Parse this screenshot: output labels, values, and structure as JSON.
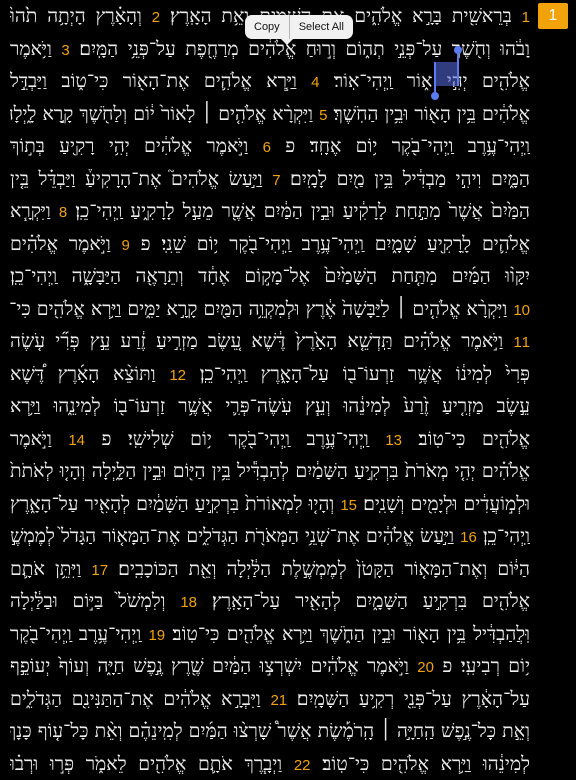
{
  "chapter_badge": "1",
  "context_menu": {
    "copy": "Copy",
    "select_all": "Select All"
  },
  "lines": [
    [
      [
        "v",
        "1"
      ],
      [
        "t",
        " בְּרֵאשִׁ֖ית בָּרָ֣א אֱלֹהִ֑ים אֵ֥ת הַשָּׁמַ֖יִם וְאֵ֥ת הָאָֽרֶץ׃ "
      ],
      [
        "v",
        "2"
      ],
      [
        "t",
        " וְהָאָ֗רֶץ הָיְתָ֥ה תֹ֙הוּ֙"
      ]
    ],
    [
      [
        "t",
        "וָבֹ֔הוּ וְחֹ֖שֶׁךְ עַל־פְּנֵ֣י תְה֑וֹם וְר֣וּחַ אֱלֹהִ֔ים מְרַחֶ֖פֶת עַל־פְּנֵ֥י הַמָּֽיִם׃ "
      ],
      [
        "v",
        "3"
      ],
      [
        "t",
        " וַיֹּ֥אמֶר"
      ]
    ],
    [
      [
        "t",
        "אֱלֹהִ֖ים יְהִ֣י א֑וֹר וַֽיְהִי־אֽוֹר׃ "
      ],
      [
        "v",
        "4"
      ],
      [
        "t",
        " וַיַּ֧רְא אֱלֹהִ֛ים אֶת־הָא֖וֹר כִּי־ט֑וֹב וַיַּבְדֵּ֣ל"
      ]
    ],
    [
      [
        "t",
        "אֱלֹהִ֔ים בֵּ֥ין הָא֖וֹר וּבֵ֥ין הַחֹֽשֶׁךְ׃ "
      ],
      [
        "v",
        "5"
      ],
      [
        "t",
        " וַיִּקְרָ֨א אֱלֹהִ֤ים ׀ לָאוֹר֙ י֔וֹם וְלַחֹ֖שֶׁךְ קָ֣רָא לָ֑יְלָה"
      ]
    ],
    [
      [
        "t",
        "וַֽיְהִי־עֶ֥רֶב וַֽיְהִי־בֹ֖קֶר י֥וֹם אֶחָֽד׃ פ "
      ],
      [
        "v",
        "6"
      ],
      [
        "t",
        " וַיֹּ֣אמֶר אֱלֹהִ֔ים יְהִ֥י רָקִ֖יעַ בְּת֣וֹךְ"
      ]
    ],
    [
      [
        "t",
        "הַמָּ֑יִם וִיהִ֣י מַבְדִּ֔יל בֵּ֥ין מַ֖יִם לָמָֽיִם׃ "
      ],
      [
        "v",
        "7"
      ],
      [
        "t",
        " וַיַּ֣עַשׂ אֱלֹהִים֮ אֶת־הָרָקִיעַ֒ וַיַּבְדֵּ֗ל בֵּ֤ין"
      ]
    ],
    [
      [
        "t",
        "הַמַּ֙יִם֙ אֲשֶׁר֙ מִתַּ֣חַת לָרָקִ֔יעַ וּבֵ֣ין הַמַּ֔יִם אֲשֶׁ֖ר מֵעַ֣ל לָרָקִ֑יעַ וַֽיְהִי־כֵֽן׃ "
      ],
      [
        "v",
        "8"
      ],
      [
        "t",
        " וַיִּקְרָ֧א"
      ]
    ],
    [
      [
        "t",
        "אֱלֹהִ֛ים לָֽרָקִ֖יעַ שָׁמָ֑יִם וַֽיְהִי־עֶ֥רֶב וַֽיְהִי־בֹ֖קֶר י֥וֹם שֵׁנִֽי׃ פ "
      ],
      [
        "v",
        "9"
      ],
      [
        "t",
        " וַיֹּ֣אמֶר אֱלֹהִ֗ים"
      ]
    ],
    [
      [
        "t",
        "יִקָּו֨וּ הַמַּ֜יִם מִתַּ֤חַת הַשָּׁמַ֙יִם֙ אֶל־מָק֣וֹם אֶחָ֔ד וְתֵרָאֶ֖ה הַיַּבָּשָׁ֑ה וַֽיְהִי־כֵֽן׃"
      ]
    ],
    [
      [
        "v",
        "10"
      ],
      [
        "t",
        " וַיִּקְרָ֨א אֱלֹהִ֤ים ׀ לַיַּבָּשָׁה֙ אֶ֔רֶץ וּלְמִקְוֵ֥ה הַמַּ֖יִם קָרָ֣א יַמִּ֑ים וַיַּ֥רְא אֱלֹהִ֖ים כִּי־טֽוֹב׃"
      ]
    ],
    [
      [
        "v",
        "11"
      ],
      [
        "t",
        " וַיֹּ֣אמֶר אֱלֹהִ֗ים תַּֽדְשֵׁ֤א הָאָ֙רֶץ֙ דֶּ֔שֶׁא עֵ֚שֶׂב מַזְרִ֣יעַ זֶ֔רַע עֵ֣ץ פְּרִ֞י עֹ֤שֶׂה"
      ]
    ],
    [
      [
        "t",
        "פְּרִי֙ לְמִינ֔וֹ אֲשֶׁ֥ר זַרְעוֹ־ב֖וֹ עַל־הָאָ֑רֶץ וַֽיְהִי־כֵֽן׃ "
      ],
      [
        "v",
        "12"
      ],
      [
        "t",
        " וַתּוֹצֵ֨א הָאָ֜רֶץ דֶּ֠שֶׁא"
      ]
    ],
    [
      [
        "t",
        "עֵ֣שֶׂב מַזְרִ֤יעַ זֶ֙רַע֙ לְמִינֵ֔הוּ וְעֵ֧ץ עֹֽשֶׂה־פְּרִ֛י אֲשֶׁ֥ר זַרְעוֹ־ב֖וֹ לְמִינֵ֑הוּ וַיַּ֥רְא"
      ]
    ],
    [
      [
        "t",
        "אֱלֹהִ֖ים כִּי־טֽוֹב׃ "
      ],
      [
        "v",
        "13"
      ],
      [
        "t",
        " וַֽיְהִי־עֶ֥רֶב וַֽיְהִי־בֹ֖קֶר י֥וֹם שְׁלִישִֽׁי׃ פ "
      ],
      [
        "v",
        "14"
      ],
      [
        "t",
        " וַיֹּ֣אמֶר"
      ]
    ],
    [
      [
        "t",
        "אֱלֹהִ֗ים יְהִ֤י מְאֹרֹת֙ בִּרְקִ֣יעַ הַשָּׁמַ֔יִם לְהַבְדִּ֕יל בֵּ֥ין הַיּ֖וֹם וּבֵ֣ין הַלָּ֑יְלָה וְהָי֤וּ לְאֹתֹת֙"
      ]
    ],
    [
      [
        "t",
        "וּלְמ֣וֹעֲדִ֔ים וּלְיָמִ֖ים וְשָׁנִֽים׃ "
      ],
      [
        "v",
        "15"
      ],
      [
        "t",
        " וְהָי֤וּ לִמְאוֹרֹת֙ בִּרְקִ֣יעַ הַשָּׁמַ֔יִם לְהָאִ֖יר עַל־הָאָ֑רֶץ"
      ]
    ],
    [
      [
        "t",
        "וַֽיְהִי־כֵֽן׃ "
      ],
      [
        "v",
        "16"
      ],
      [
        "t",
        " וַיַּ֣עַשׂ אֱלֹהִ֔ים אֶת־שְׁנֵ֥י הַמְּאֹרֹ֖ת הַגְּדֹלִ֑ים אֶת־הַמָּא֤וֹר הַגָּדֹל֙ לְמֶמְשֶׁ֣לֶת"
      ]
    ],
    [
      [
        "t",
        "הַיּ֔וֹם וְאֶת־הַמָּא֤וֹר הַקָּטֹן֙ לְמֶמְשֶׁ֣לֶת הַלַּ֔יְלָה וְאֵ֖ת הַכּוֹכָבִֽים׃ "
      ],
      [
        "v",
        "17"
      ],
      [
        "t",
        " וַיִּתֵּ֥ן אֹתָ֛ם"
      ]
    ],
    [
      [
        "t",
        "אֱלֹהִ֖ים בִּרְקִ֣יעַ הַשָּׁמָ֑יִם לְהָאִ֖יר עַל־הָאָֽרֶץ׃ "
      ],
      [
        "v",
        "18"
      ],
      [
        "t",
        " וְלִמְשֹׁל֙ בַּיּ֣וֹם וּבַלַּ֔יְלָה"
      ]
    ],
    [
      [
        "t",
        "וּֽלֲהַבְדִּ֔יל בֵּ֥ין הָא֖וֹר וּבֵ֣ין הַחֹ֑שֶׁךְ וַיַּ֥רְא אֱלֹהִ֖ים כִּי־טֽוֹב׃ "
      ],
      [
        "v",
        "19"
      ],
      [
        "t",
        " וַֽיְהִי־עֶ֥רֶב וַֽיְהִי־בֹ֖קֶר"
      ]
    ],
    [
      [
        "t",
        "י֥וֹם רְבִיעִֽי׃ פ "
      ],
      [
        "v",
        "20"
      ],
      [
        "t",
        " וַיֹּ֣אמֶר אֱלֹהִ֔ים יִשְׁרְצ֣וּ הַמַּ֔יִם שֶׁ֖רֶץ נֶ֣פֶשׁ חַיָּ֑ה וְעוֹף֙ יְעוֹפֵ֣ף"
      ]
    ],
    [
      [
        "t",
        "עַל־הָאָ֔רֶץ עַל־פְּנֵ֖י רְקִ֥יעַ הַשָּׁמָֽיִם׃ "
      ],
      [
        "v",
        "21"
      ],
      [
        "t",
        " וַיִּבְרָ֣א אֱלֹהִ֔ים אֶת־הַתַּנִּינִ֖ם הַגְּדֹלִ֑ים"
      ]
    ],
    [
      [
        "t",
        "וְאֵ֣ת כָּל־נֶ֣פֶשׁ הַֽחַיָּ֣ה ׀ הָֽרֹמֶ֡שֶׂת אֲשֶׁר֩ שָׁרְצ֨וּ הַמַּ֜יִם לְמִֽינֵהֶ֗ם וְאֵ֨ת כָּל־ע֤וֹף כָּנָף֙"
      ]
    ],
    [
      [
        "t",
        "לְמִינֵ֔הוּ וַיַּ֥רְא אֱלֹהִ֖ים כִּי־טֽוֹב׃ "
      ],
      [
        "v",
        "22"
      ],
      [
        "t",
        " וַיְבָ֧רֶךְ אֹתָ֛ם אֱלֹהִ֖ים לֵאמֹ֑ר פְּר֣וּ וּרְב֗וּ"
      ]
    ]
  ]
}
